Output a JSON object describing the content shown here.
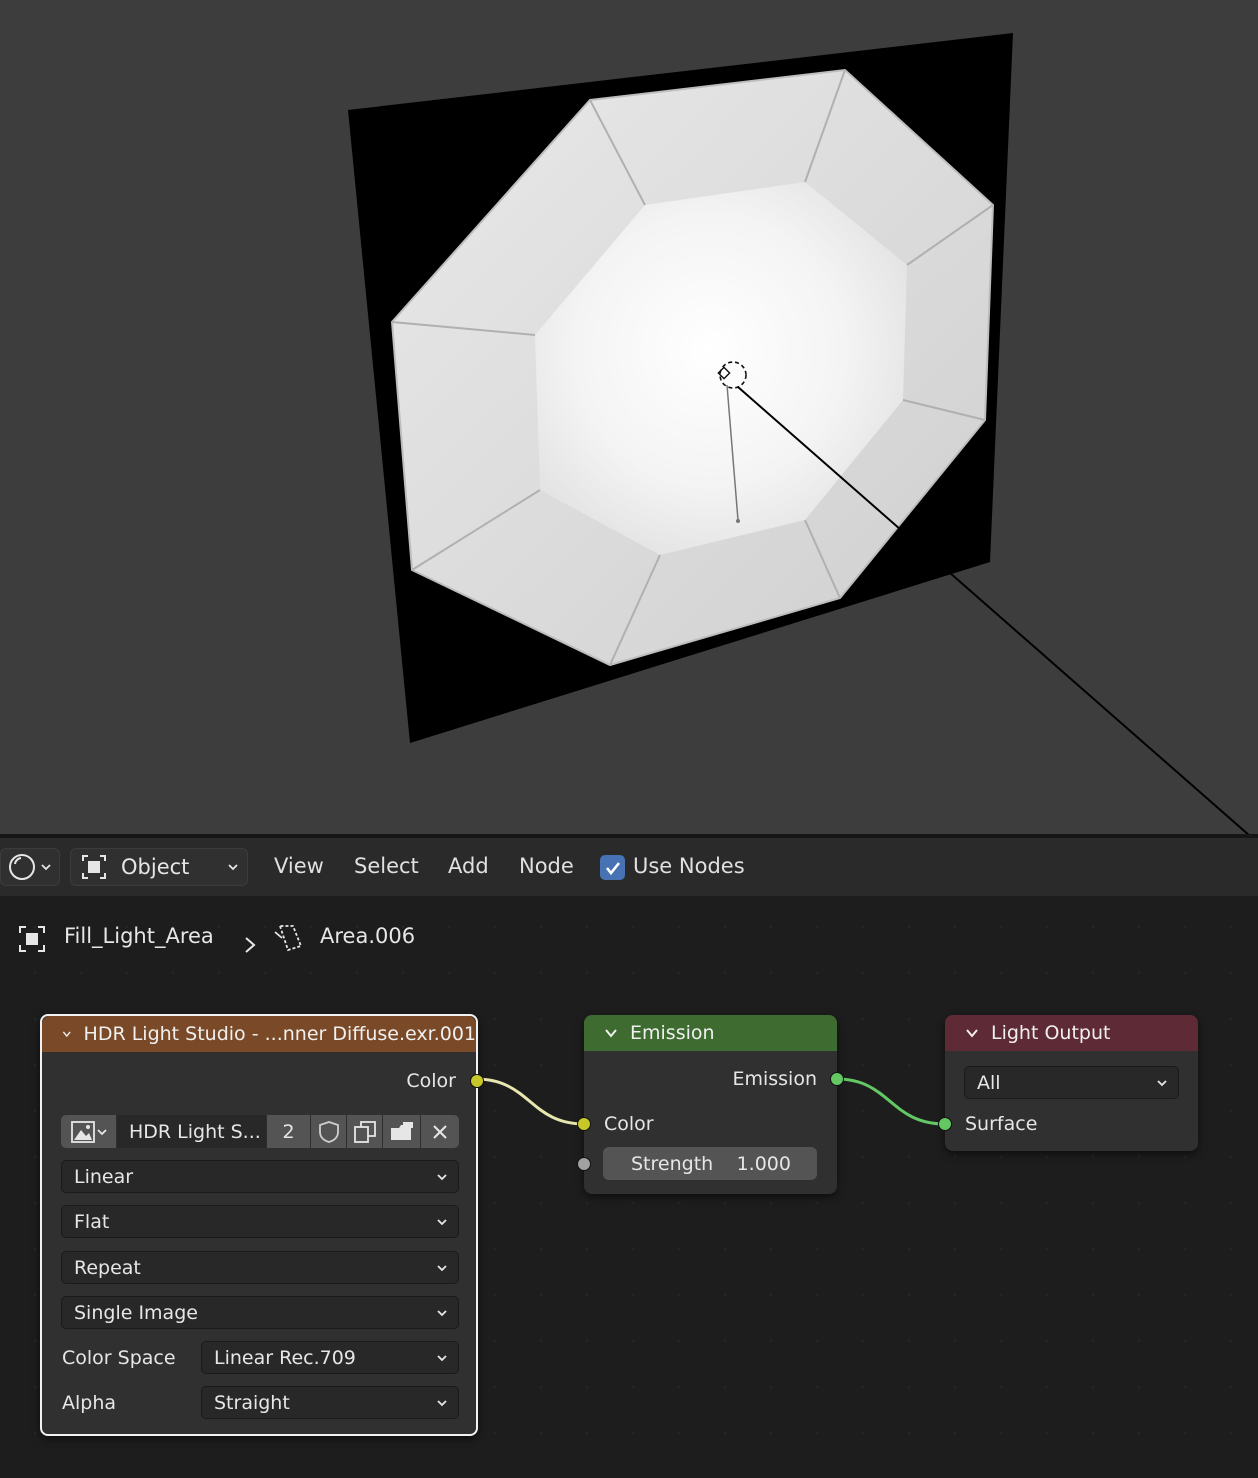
{
  "header": {
    "object_mode": "Object",
    "menus": [
      "View",
      "Select",
      "Add",
      "Node"
    ],
    "use_nodes_label": "Use Nodes",
    "use_nodes_checked": true
  },
  "breadcrumb": {
    "object": "Fill_Light_Area",
    "data": "Area.006"
  },
  "nodes": {
    "image": {
      "title": "HDR Light Studio - ...nner Diffuse.exr.001",
      "output_color": "Color",
      "image_name": "HDR Light S...",
      "user_count": "2",
      "interpolation": "Linear",
      "projection": "Flat",
      "extension": "Repeat",
      "source": "Single Image",
      "color_space_label": "Color Space",
      "color_space": "Linear Rec.709",
      "alpha_label": "Alpha",
      "alpha": "Straight",
      "header_color": "#7a4a28"
    },
    "emission": {
      "title": "Emission",
      "output": "Emission",
      "input_color": "Color",
      "strength_label": "Strength",
      "strength_value": "1.000",
      "header_color": "#3d6b30"
    },
    "output": {
      "title": "Light Output",
      "target": "All",
      "input_surface": "Surface",
      "header_color": "#5e2a35"
    }
  },
  "colors": {
    "color_socket": "#c7c729",
    "shader_socket": "#63c763",
    "value_socket": "#a1a1a1",
    "checkbox": "#4772b3"
  }
}
